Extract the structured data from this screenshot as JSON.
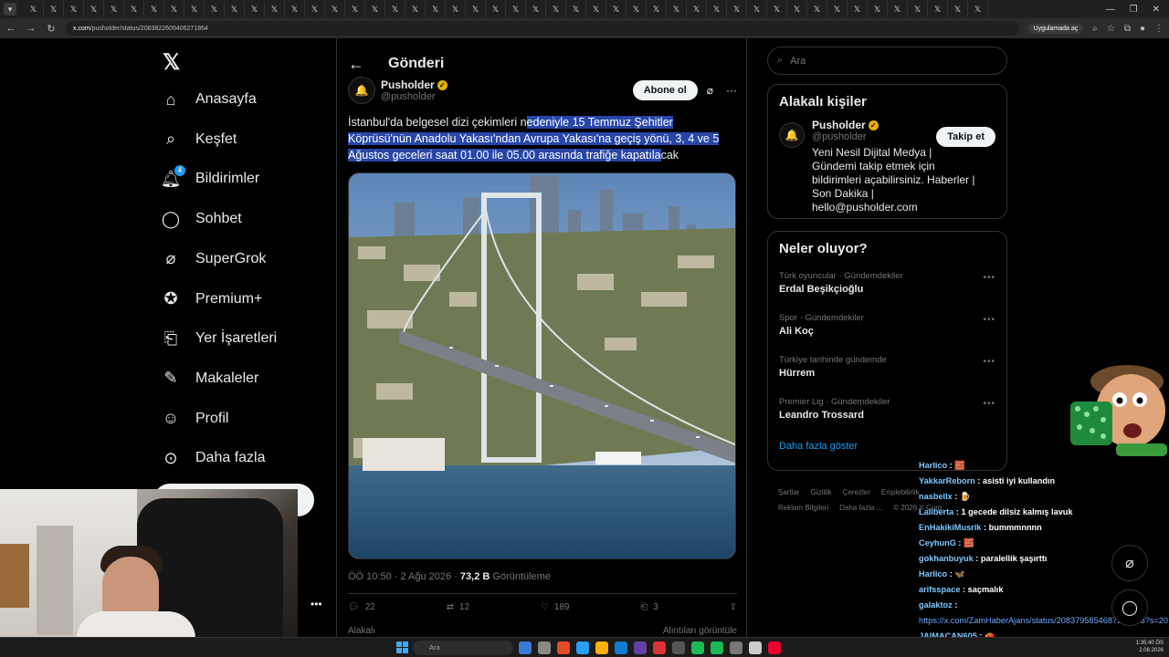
{
  "browser": {
    "url_host": "x.com",
    "url_path": "/pusholder/status/2083822609406271864",
    "app_pill": "Uygulamada aç"
  },
  "nav": {
    "items": [
      {
        "label": "Anasayfa",
        "icon": "home-icon"
      },
      {
        "label": "Keşfet",
        "icon": "search-icon"
      },
      {
        "label": "Bildirimler",
        "icon": "bell-icon",
        "badge": "4"
      },
      {
        "label": "Sohbet",
        "icon": "chat-icon"
      },
      {
        "label": "SuperGrok",
        "icon": "grok-icon"
      },
      {
        "label": "Premium+",
        "icon": "premium-icon"
      },
      {
        "label": "Yer İşaretleri",
        "icon": "bookmark-icon"
      },
      {
        "label": "Makaleler",
        "icon": "article-icon"
      },
      {
        "label": "Profil",
        "icon": "profile-icon"
      },
      {
        "label": "Daha fazla",
        "icon": "more-icon"
      }
    ]
  },
  "post": {
    "header_title": "Gönderi",
    "author_name": "Pusholder",
    "author_handle": "@pusholder",
    "follow_label": "Abone ol",
    "text_plain": "İstanbul'da belgesel dizi çekimleri n",
    "text_highlighted": "edeniyle 15 Temmuz Şehitler Köprüsü'nün Anadolu Yakası'ndan Avrupa Yakası'na geçiş yönü, 3, 4 ve 5 Ağustos geceleri saat 01.00 ile 05.00 arasında trafiğe kapatıla",
    "text_tail": "cak",
    "time": "ÖÖ 10:50 · 2 Ağu 2026 ·",
    "views": "73,2 B",
    "views_label": "Görüntüleme",
    "replies": "22",
    "reposts": "12",
    "likes": "189",
    "bookmarks": "3",
    "bottom_left": "Alakalı",
    "bottom_right": "Alıntıları görüntüle"
  },
  "right": {
    "search_placeholder": "Ara",
    "related_title": "Alakalı kişiler",
    "person_name": "Pusholder",
    "person_handle": "@pusholder",
    "person_follow": "Takip et",
    "person_bio": "Yeni Nesil Dijital Medya | Gündemi takip etmek için bildirimleri açabilirsiniz. Haberler | Son Dakika | hello@pusholder.com",
    "trends_title": "Neler oluyor?",
    "trends": [
      {
        "context": "Türk oyuncular · Gündemdekiler",
        "name": "Erdal Beşikçioğlu"
      },
      {
        "context": "Spor · Gündemdekiler",
        "name": "Ali Koç"
      },
      {
        "context": "Türkiye tarihinde gündemde",
        "name": "Hürrem"
      },
      {
        "context": "Premier Lig · Gündemdekiler",
        "name": "Leandro Trossard"
      }
    ],
    "show_more": "Daha fazla göster",
    "footer_row1": [
      "Şartlar",
      "Gizlilik",
      "Çerezler",
      "Erişilebilirlik"
    ],
    "footer_row2": [
      "Reklam Bilgileri",
      "Daha fazla ...",
      "© 2026 X Corp."
    ]
  },
  "chat": [
    {
      "user": "Harlico",
      "msg": ": 🧱"
    },
    {
      "user": "YakkarReborn",
      "msg": ": asisti iyi kullandın"
    },
    {
      "user": "nasbellx",
      "msg": ": 🍺"
    },
    {
      "user": "Laliberta",
      "msg": ": 1 gecede dilsiz kalmış lavuk"
    },
    {
      "user": "EnHakikiMusrik",
      "msg": ": bummmnnnn"
    },
    {
      "user": "CeyhunG",
      "msg": ": 🧱"
    },
    {
      "user": "gokhanbuyuk",
      "msg": ": paralellik şaşırttı"
    },
    {
      "user": "Harlico",
      "msg": ": 🦋"
    },
    {
      "user": "arifsspace",
      "msg": ": saçmalık"
    },
    {
      "user": "galaktoz",
      "msg": ":"
    },
    {
      "user": "JAIMACAN605",
      "msg": ": 🍅"
    }
  ],
  "chat_link": "https://x.com/ZamHaberAjans/status/2083795854687670403?s=20",
  "taskbar": {
    "search": "Ara",
    "time": "1:35:40 ÖS",
    "date": "2.08.2026"
  },
  "colors": {
    "accent": "#1d9bf0",
    "highlight": "#2846a8",
    "verified": "#e8b100"
  }
}
